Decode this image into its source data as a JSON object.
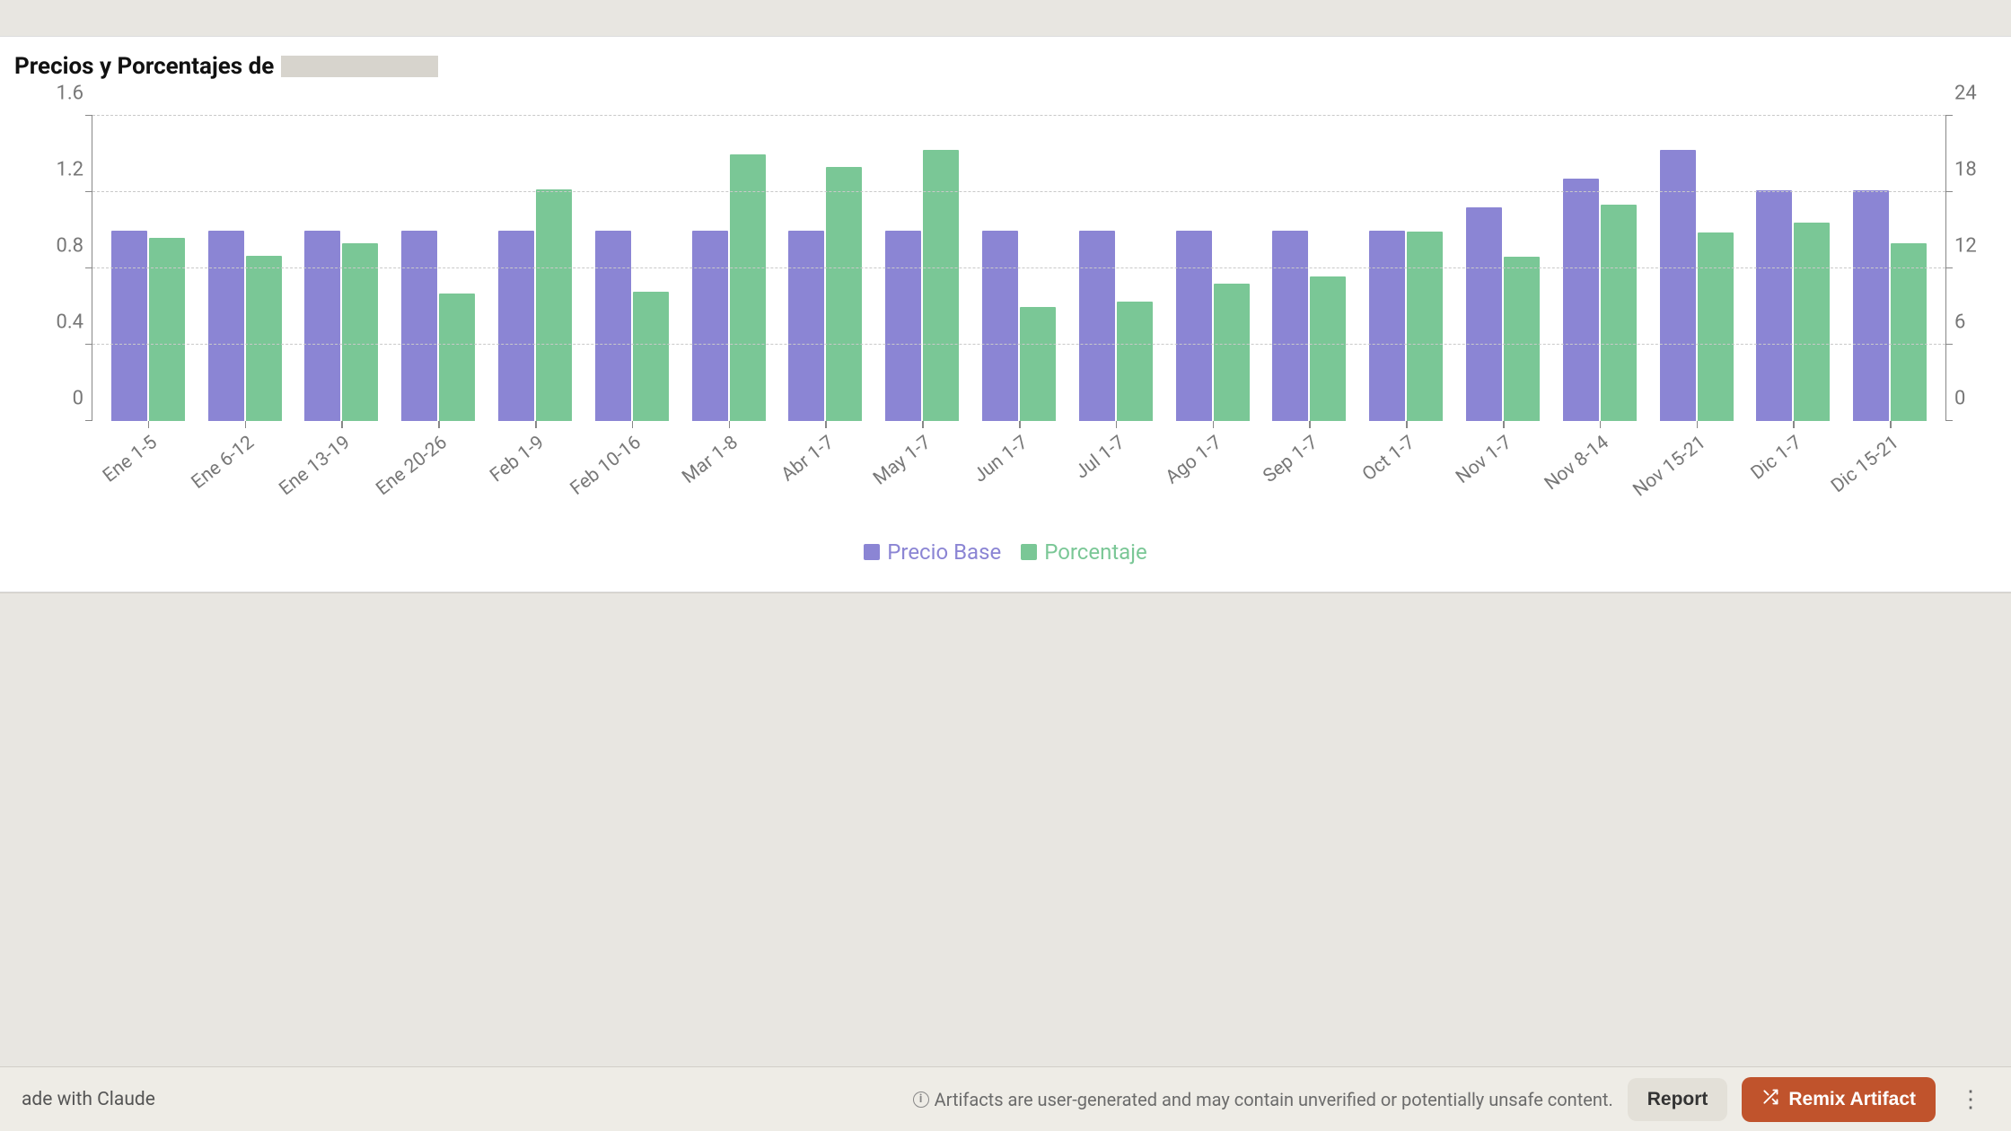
{
  "title_prefix": "Precios y Porcentajes de",
  "chart_data": {
    "type": "bar",
    "categories": [
      "Ene 1-5",
      "Ene 6-12",
      "Ene 13-19",
      "Ene 20-26",
      "Feb 1-9",
      "Feb 10-16",
      "Mar 1-8",
      "Abr 1-7",
      "May 1-7",
      "Jun 1-7",
      "Jul 1-7",
      "Ago 1-7",
      "Sep 1-7",
      "Oct 1-7",
      "Nov 1-7",
      "Nov 8-14",
      "Nov 15-21",
      "Dic 1-7",
      "Dic 15-21"
    ],
    "series": [
      {
        "name": "Precio Base",
        "axis": "left",
        "color": "#8b85d4",
        "values": [
          1.0,
          1.0,
          1.0,
          1.0,
          1.0,
          1.0,
          1.0,
          1.0,
          1.0,
          1.0,
          1.0,
          1.0,
          1.0,
          1.0,
          1.12,
          1.27,
          1.42,
          1.21,
          1.21
        ]
      },
      {
        "name": "Porcentaje",
        "axis": "right",
        "color": "#7ac796",
        "values": [
          14.4,
          13.0,
          14.0,
          10.0,
          18.2,
          10.2,
          21.0,
          20.0,
          21.3,
          9.0,
          9.4,
          10.8,
          11.4,
          14.9,
          12.9,
          17.0,
          14.8,
          15.6,
          14.0
        ]
      }
    ],
    "y_left": {
      "min": 0,
      "max": 1.6,
      "ticks": [
        0,
        0.4,
        0.8,
        1.2,
        1.6
      ]
    },
    "y_right": {
      "min": 0,
      "max": 24,
      "ticks": [
        0,
        6,
        12,
        18,
        24
      ]
    },
    "legend": [
      "Precio Base",
      "Porcentaje"
    ]
  },
  "footer": {
    "made_with": "ade with Claude",
    "warning": "Artifacts are user-generated and may contain unverified or potentially unsafe content.",
    "report": "Report",
    "remix": "Remix Artifact"
  }
}
